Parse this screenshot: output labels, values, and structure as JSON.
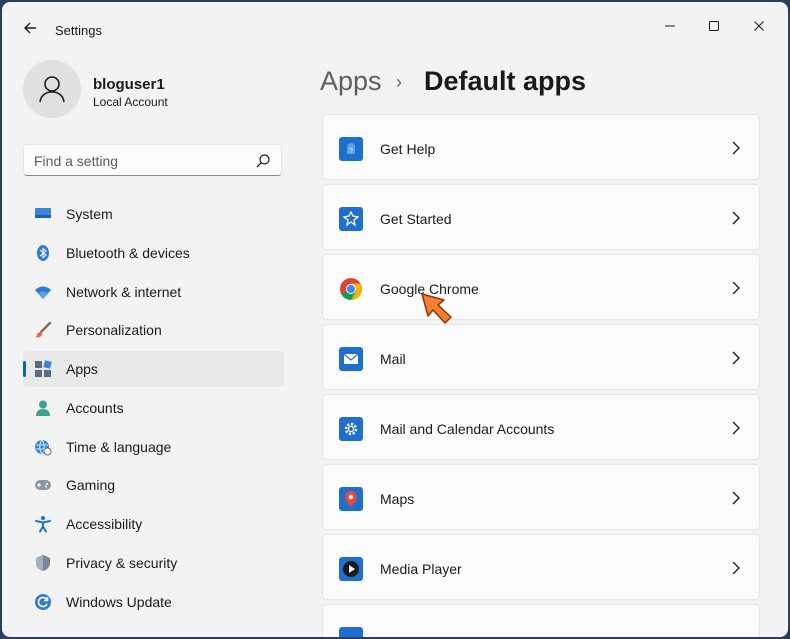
{
  "window": {
    "title": "Settings"
  },
  "user": {
    "name": "bloguser1",
    "account_type": "Local Account"
  },
  "search": {
    "placeholder": "Find a setting"
  },
  "sidebar": {
    "items": [
      {
        "label": "System",
        "icon": "monitor-icon"
      },
      {
        "label": "Bluetooth & devices",
        "icon": "bluetooth-icon"
      },
      {
        "label": "Network & internet",
        "icon": "wifi-icon"
      },
      {
        "label": "Personalization",
        "icon": "brush-icon"
      },
      {
        "label": "Apps",
        "icon": "apps-icon",
        "selected": true
      },
      {
        "label": "Accounts",
        "icon": "person-icon"
      },
      {
        "label": "Time & language",
        "icon": "globe-clock-icon"
      },
      {
        "label": "Gaming",
        "icon": "gamepad-icon"
      },
      {
        "label": "Accessibility",
        "icon": "accessibility-icon"
      },
      {
        "label": "Privacy & security",
        "icon": "shield-icon"
      },
      {
        "label": "Windows Update",
        "icon": "update-icon"
      }
    ]
  },
  "breadcrumb": {
    "parent": "Apps",
    "separator": "›",
    "current": "Default apps"
  },
  "default_apps": [
    {
      "label": "Get Help",
      "icon": "get-help-icon"
    },
    {
      "label": "Get Started",
      "icon": "get-started-icon"
    },
    {
      "label": "Google Chrome",
      "icon": "chrome-icon"
    },
    {
      "label": "Mail",
      "icon": "mail-icon"
    },
    {
      "label": "Mail and Calendar Accounts",
      "icon": "gear-icon"
    },
    {
      "label": "Maps",
      "icon": "maps-icon"
    },
    {
      "label": "Media Player",
      "icon": "media-player-icon"
    },
    {
      "label": "",
      "icon": "app-icon"
    }
  ],
  "colors": {
    "accent": "#0067c0",
    "background": "#f3f3f3",
    "card": "#fbfbfb",
    "pointer": "#f0812d"
  }
}
